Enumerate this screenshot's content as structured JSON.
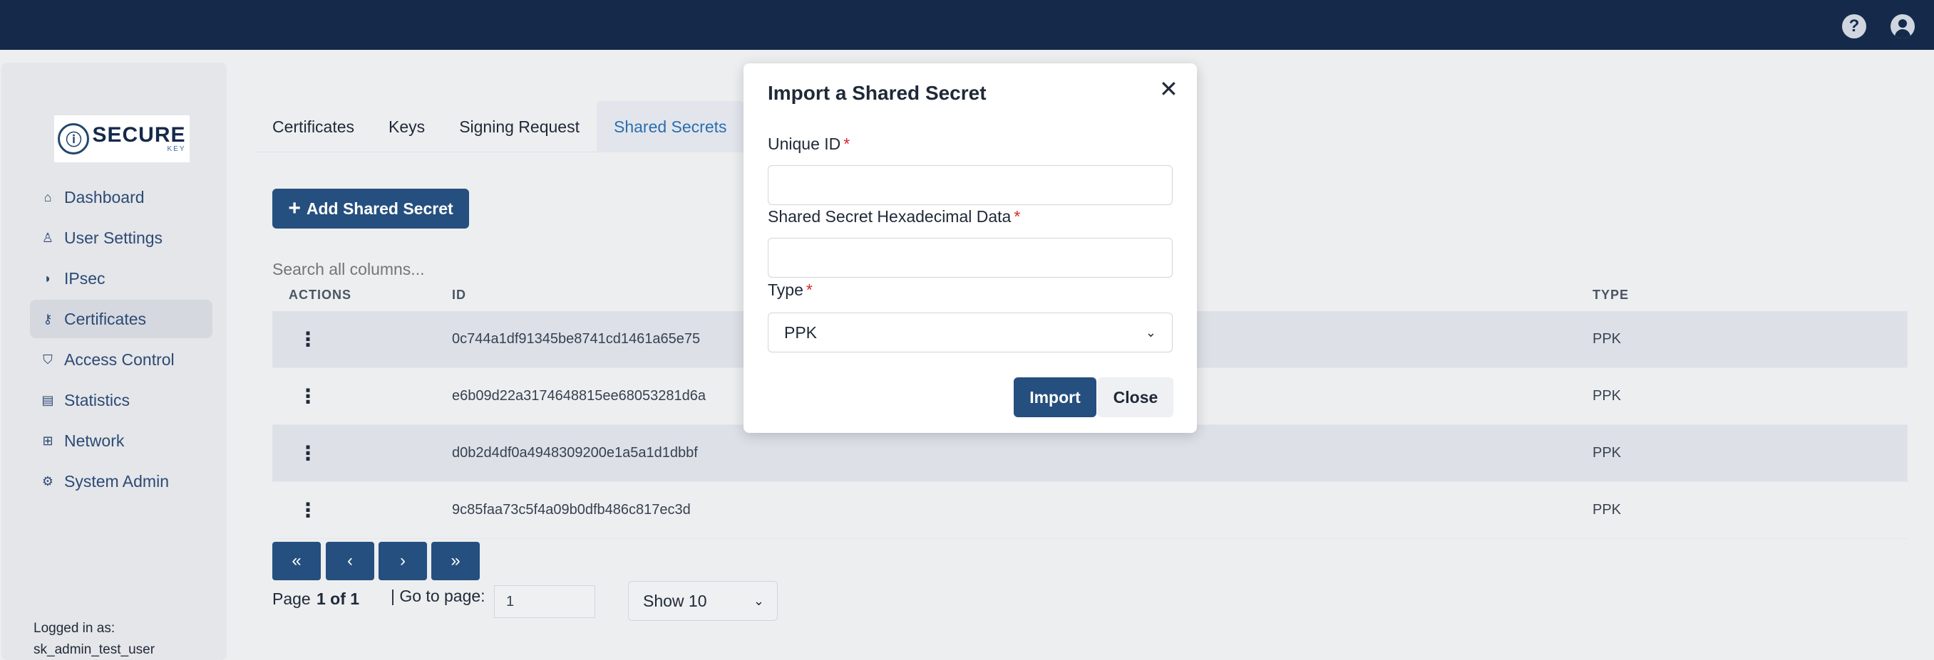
{
  "header": {
    "help_icon": "?",
    "user_icon": "user-circle-icon"
  },
  "sidebar": {
    "logo": {
      "brand": "SECURE",
      "sub": "KEY"
    },
    "items": [
      {
        "label": "Dashboard",
        "icon": "home-icon",
        "glyph": "⌂"
      },
      {
        "label": "User Settings",
        "icon": "user-icon",
        "glyph": "♙"
      },
      {
        "label": "IPsec",
        "icon": "shield-icon",
        "glyph": "◗"
      },
      {
        "label": "Certificates",
        "icon": "key-icon",
        "glyph": "⚷"
      },
      {
        "label": "Access Control",
        "icon": "shield-lock-icon",
        "glyph": "⛉"
      },
      {
        "label": "Statistics",
        "icon": "chart-icon",
        "glyph": "▤"
      },
      {
        "label": "Network",
        "icon": "network-icon",
        "glyph": "⊞"
      },
      {
        "label": "System Admin",
        "icon": "gear-icon",
        "glyph": "⚙"
      }
    ],
    "logged_in_label": "Logged in as:",
    "logged_in_user": "sk_admin_test_user"
  },
  "tabs": [
    "Certificates",
    "Keys",
    "Signing Request",
    "Shared Secrets"
  ],
  "toolbar": {
    "add_label": "Add Shared Secret",
    "search_placeholder": "Search all columns..."
  },
  "table": {
    "headers": {
      "actions": "ACTIONS",
      "id": "ID",
      "type": "TYPE"
    },
    "rows": [
      {
        "id": "0c744a1df91345be8741cd1461a65e75",
        "type": "PPK"
      },
      {
        "id": "e6b09d22a3174648815ee68053281d6a",
        "type": "PPK"
      },
      {
        "id": "d0b2d4df0a4948309200e1a5a1d1dbbf",
        "type": "PPK"
      },
      {
        "id": "9c85faa73c5f4a09b0dfb486c817ec3d",
        "type": "PPK"
      }
    ]
  },
  "pagination": {
    "first": "«",
    "prev": "‹",
    "next": "›",
    "last": "»",
    "page_label": "Page",
    "page_value": "1 of 1",
    "goto_label": "| Go to page:",
    "goto_value": "1",
    "show_value": "Show 10"
  },
  "modal": {
    "title": "Import a Shared Secret",
    "unique_id_label": "Unique ID",
    "hex_label": "Shared Secret Hexadecimal Data",
    "type_label": "Type",
    "required_mark": "*",
    "type_value": "PPK",
    "import_label": "Import",
    "close_label": "Close"
  }
}
